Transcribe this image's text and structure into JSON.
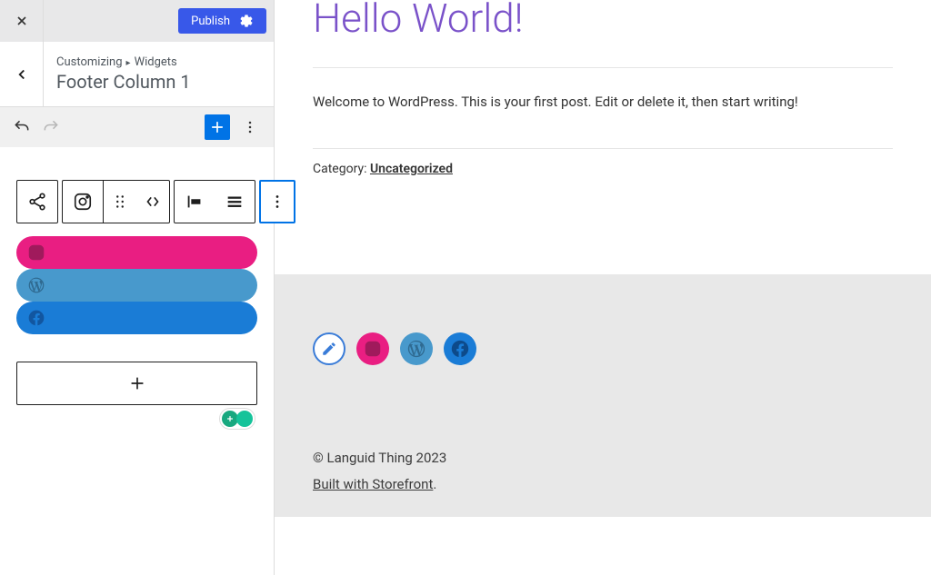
{
  "header": {
    "publish_label": "Publish"
  },
  "nav": {
    "breadcrumb_root": "Customizing",
    "breadcrumb_child": "Widgets",
    "section_title": "Footer Column 1"
  },
  "preview": {
    "title": "Hello World!",
    "body": "Welcome to WordPress. This is your first post. Edit or delete it, then start writing!",
    "category_label": "Category: ",
    "category_link": "Uncategorized"
  },
  "footer": {
    "copyright": "© Languid Thing 2023",
    "built_with": "Built with Storefront"
  }
}
